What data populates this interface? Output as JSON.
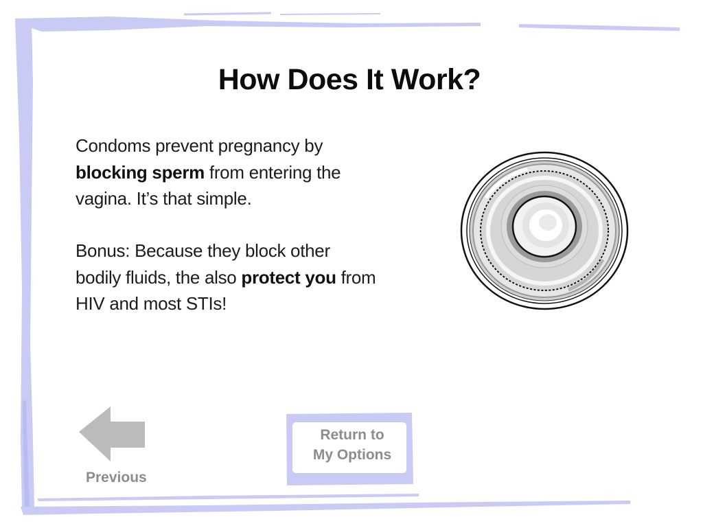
{
  "page": {
    "title": "How Does It Work?"
  },
  "paragraph_1": {
    "part_1": "Condoms prevent pregnancy by ",
    "bold_1": "blocking sperm",
    "part_2": " from entering the vagina. It’s that simple."
  },
  "paragraph_2": {
    "part_1": "Bonus: Because they block other bodily fluids, the also ",
    "bold_1": "protect you",
    "part_2": " from HIV and most STIs!"
  },
  "navigation": {
    "previous_label": "Previous",
    "return_line_1": "Return to",
    "return_line_2": "My Options"
  },
  "icons": {
    "illustration": "condom-illustration",
    "previous": "left-arrow-icon"
  },
  "colors": {
    "frame": "#c9cbf5",
    "frame_dark": "#b9bcf0",
    "button_gray": "#bbbbbb",
    "label_gray": "#8c8c8c",
    "text": "#1c1c1c"
  }
}
